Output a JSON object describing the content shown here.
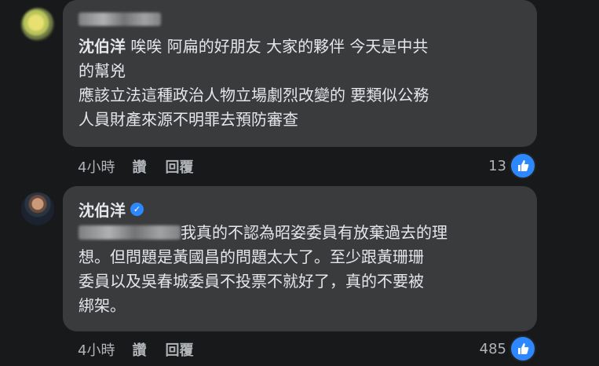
{
  "comments": [
    {
      "author_visible": false,
      "mention": "沈伯洋",
      "text_first": " 唉唉 阿扁的好朋友 大家的夥伴 今天是中共\n的幫兇\n應該立法這種政治人物立場劇烈改變的 要類似公務\n人員財產來源不明罪去預防審查",
      "time": "4小時",
      "like_label": "讚",
      "reply_label": "回覆",
      "reaction_count": "13"
    },
    {
      "author": "沈伯洋",
      "verified": true,
      "text": "我真的不認為昭姿委員有放棄過去的理\n想。但問題是黃國昌的問題太大了。至少跟黃珊珊\n委員以及吳春城委員不投票不就好了，真的不要被\n綁架。",
      "time": "4小時",
      "like_label": "讚",
      "reply_label": "回覆",
      "reaction_count": "485"
    }
  ],
  "colors": {
    "background": "#18191a",
    "bubble": "#3a3b3c",
    "text": "#e4e6eb",
    "muted": "#b0b3b8",
    "accent": "#2d88ff"
  },
  "icons": {
    "like": "thumbs-up-icon",
    "verified": "verified-badge-icon"
  }
}
